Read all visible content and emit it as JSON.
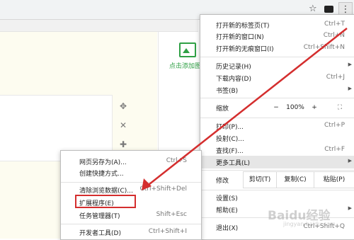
{
  "addsite_label": "点击添加图",
  "main_menu": {
    "new_tab": {
      "label": "打开新的标签页(T)",
      "shortcut": "Ctrl+T"
    },
    "new_window": {
      "label": "打开新的窗口(N)",
      "shortcut": "Ctrl+N"
    },
    "incognito": {
      "label": "打开新的无痕窗口(I)",
      "shortcut": "Ctrl+Shift+N"
    },
    "history": {
      "label": "历史记录(H)"
    },
    "downloads": {
      "label": "下载内容(D)",
      "shortcut": "Ctrl+J"
    },
    "bookmarks": {
      "label": "书签(B)"
    },
    "zoom": {
      "label": "缩放",
      "minus": "−",
      "value": "100%",
      "plus": "+"
    },
    "print": {
      "label": "打印(P)...",
      "shortcut": "Ctrl+P"
    },
    "cast": {
      "label": "投射(C)..."
    },
    "find": {
      "label": "查找(F)...",
      "shortcut": "Ctrl+F"
    },
    "more_tools": {
      "label": "更多工具(L)"
    },
    "edit": {
      "label": "修改",
      "cut": "剪切(T)",
      "copy": "复制(C)",
      "paste": "粘贴(P)"
    },
    "settings": {
      "label": "设置(S)"
    },
    "help": {
      "label": "帮助(E)"
    },
    "exit": {
      "label": "退出(X)",
      "shortcut": "Ctrl+Shift+Q"
    }
  },
  "sub_menu": {
    "save_page": {
      "label": "网页另存为(A)...",
      "shortcut": "Ctrl+S"
    },
    "create_shortcut": {
      "label": "创建快捷方式..."
    },
    "clear_data": {
      "label": "清除浏览数据(C)...",
      "shortcut": "Ctrl+Shift+Del"
    },
    "extensions": {
      "label": "扩展程序(E)"
    },
    "task_manager": {
      "label": "任务管理器(T)",
      "shortcut": "Shift+Esc"
    },
    "dev_tools": {
      "label": "开发者工具(D)",
      "shortcut": "Ctrl+Shift+I"
    }
  },
  "watermark": {
    "text": "Baidu经验",
    "url": "jingyan.baidu.com"
  },
  "colors": {
    "highlight_box": "#d42e2e",
    "arrow": "#d42e2e",
    "accent_green": "#2fa045"
  }
}
